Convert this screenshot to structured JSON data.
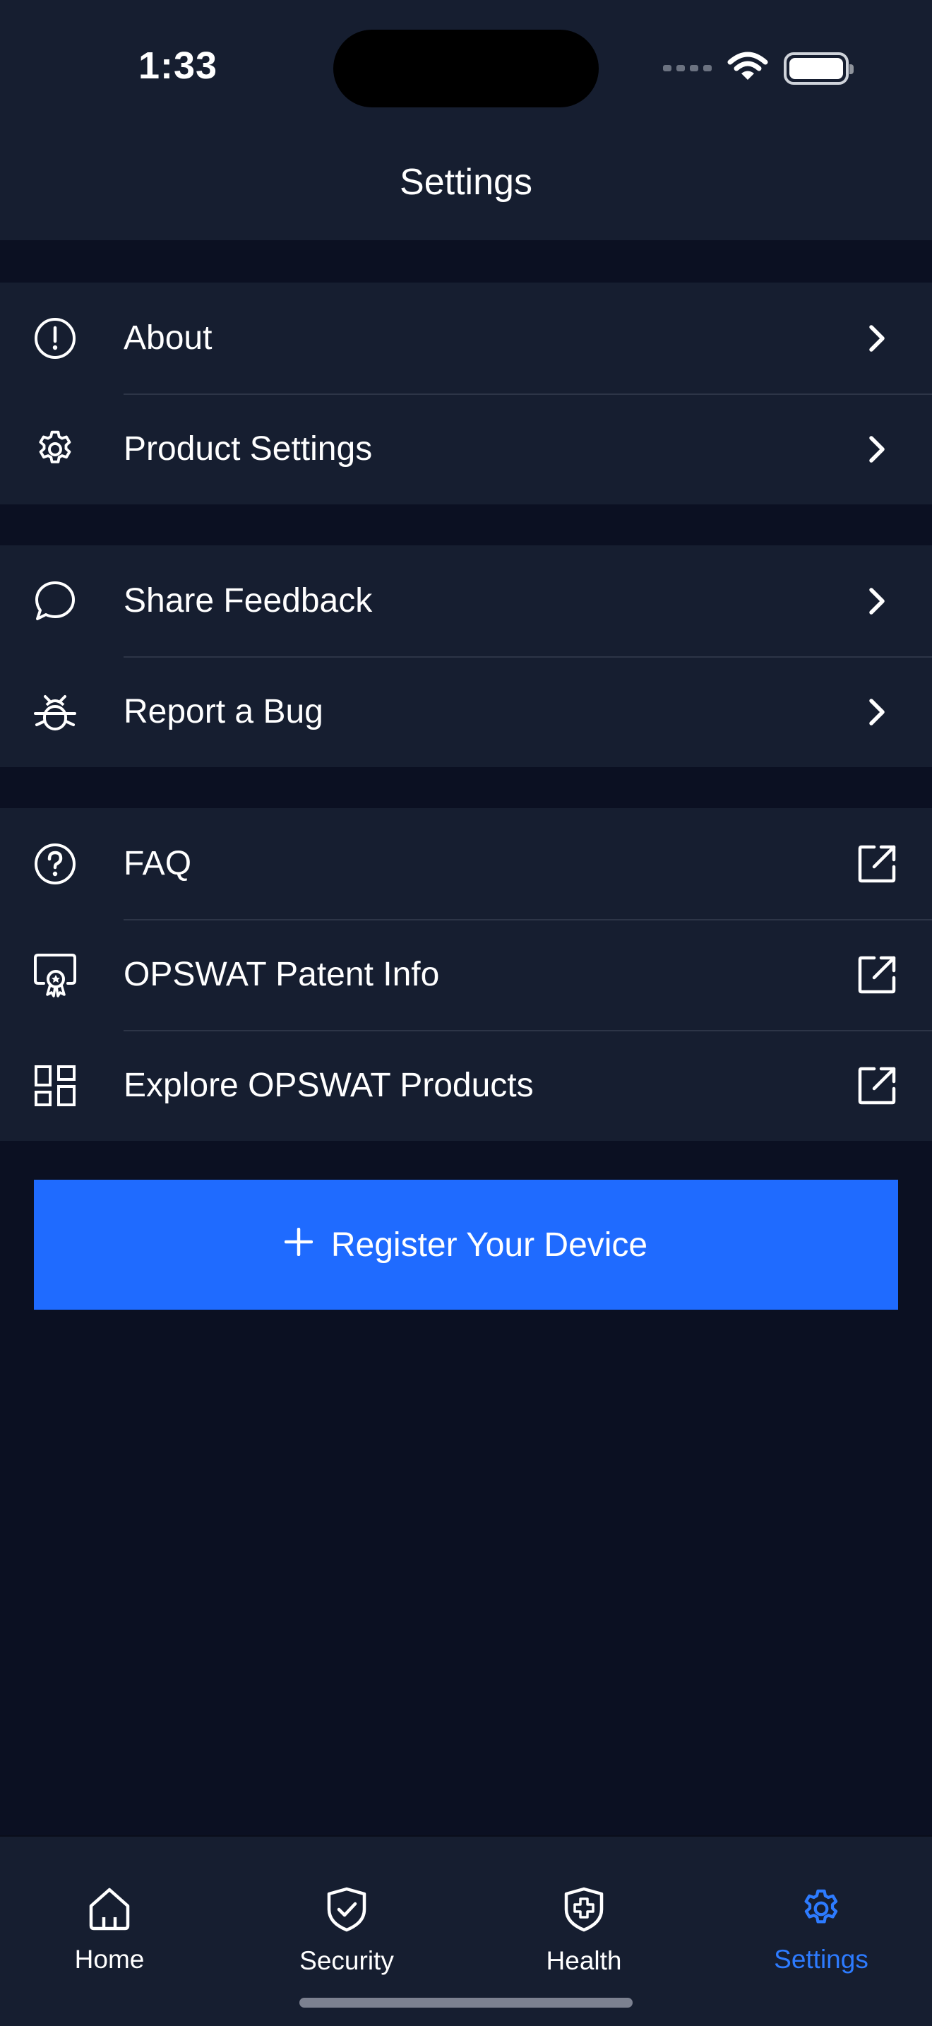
{
  "status_bar": {
    "time": "1:33"
  },
  "header": {
    "title": "Settings"
  },
  "sections": [
    {
      "items": [
        {
          "label": "About",
          "icon": "info-circle-icon",
          "trailing": "chevron-right-icon"
        },
        {
          "label": "Product Settings",
          "icon": "gear-icon",
          "trailing": "chevron-right-icon"
        }
      ]
    },
    {
      "items": [
        {
          "label": "Share Feedback",
          "icon": "chat-bubble-icon",
          "trailing": "chevron-right-icon"
        },
        {
          "label": "Report a Bug",
          "icon": "bug-icon",
          "trailing": "chevron-right-icon"
        }
      ]
    },
    {
      "items": [
        {
          "label": "FAQ",
          "icon": "question-circle-icon",
          "trailing": "external-link-icon"
        },
        {
          "label": "OPSWAT Patent Info",
          "icon": "certificate-icon",
          "trailing": "external-link-icon"
        },
        {
          "label": "Explore OPSWAT Products",
          "icon": "dashboard-grid-icon",
          "trailing": "external-link-icon"
        }
      ]
    }
  ],
  "register_button": {
    "label": "Register Your Device",
    "icon": "plus-icon"
  },
  "tabbar": {
    "tabs": [
      {
        "label": "Home",
        "icon": "home-icon",
        "active": false
      },
      {
        "label": "Security",
        "icon": "shield-check-icon",
        "active": false
      },
      {
        "label": "Health",
        "icon": "shield-plus-icon",
        "active": false
      },
      {
        "label": "Settings",
        "icon": "gear-icon",
        "active": true
      }
    ]
  },
  "colors": {
    "background": "#0b1022",
    "surface": "#161e30",
    "divider": "#2d3547",
    "accent": "#1f6bff",
    "active_tab": "#2d7bff"
  }
}
